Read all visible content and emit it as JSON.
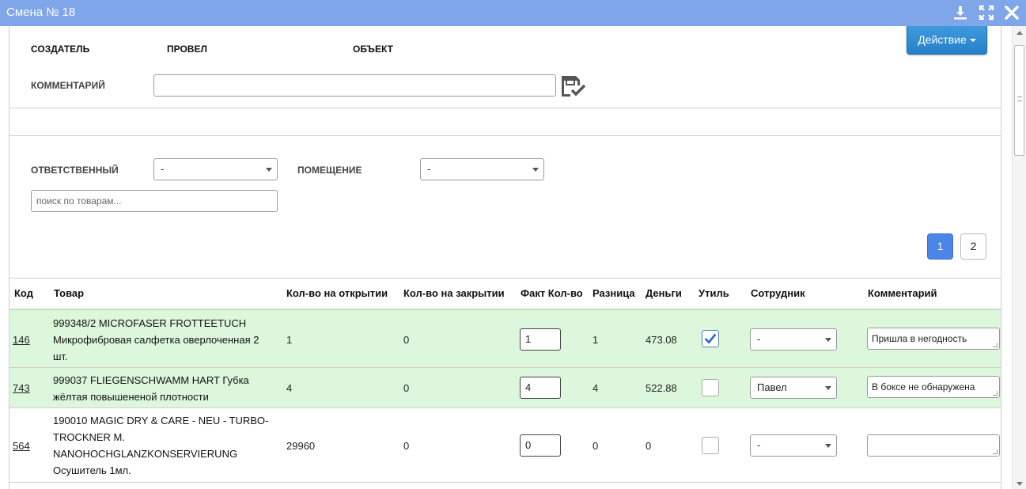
{
  "window": {
    "title": "Смена № 18"
  },
  "header": {
    "creator_label": "СОЗДАТЕЛЬ",
    "conducted_label": "ПРОВЕЛ",
    "object_label": "ОБЪЕКТ",
    "comment_label": "КОММЕНТАРИЙ",
    "comment_value": "",
    "action_label": "Действие"
  },
  "filters": {
    "responsible_label": "ОТВЕТСТВЕННЫЙ",
    "responsible_value": "-",
    "room_label": "ПОМЕЩЕНИЕ",
    "room_value": "-",
    "search_placeholder": "поиск по товарам..."
  },
  "pagination": {
    "pages": [
      "1",
      "2"
    ],
    "active": "1"
  },
  "table": {
    "columns": [
      "Код",
      "Товар",
      "Кол-во на открытии",
      "Кол-во на закрытии",
      "Факт Кол-во",
      "Разница",
      "Деньги",
      "Утиль",
      "Сотрудник",
      "Комментарий"
    ],
    "rows": [
      {
        "code": "146",
        "product_lines": [
          "999348/2 MICROFASER FROTTEETUCH",
          "Микрофибровая салфетка оверлоченная 2",
          "шт."
        ],
        "qty_open": "1",
        "qty_close": "0",
        "fact": "1",
        "diff": "1",
        "money": "473.08",
        "util": true,
        "employee": "-",
        "comment": "Пришла в негодность"
      },
      {
        "code": "743",
        "product_lines": [
          "999037 FLIEGENSCHWAMM HART Губка",
          "жёлтая повышененой плотности"
        ],
        "qty_open": "4",
        "qty_close": "0",
        "fact": "4",
        "diff": "4",
        "money": "522.88",
        "util": false,
        "employee": "Павел",
        "comment": "В боксе не обнаружена"
      },
      {
        "code": "564",
        "product_lines": [
          "190010 MAGIC DRY & CARE - NEU - TURBO-",
          "TROCKNER M.",
          "NANOHOCHGLANZKONSERVIERUNG",
          "Осушитель 1мл."
        ],
        "qty_open": "29960",
        "qty_close": "0",
        "fact": "0",
        "diff": "0",
        "money": "0",
        "util": false,
        "employee": "-",
        "comment": ""
      }
    ]
  },
  "colors": {
    "titlebar": "#7ea6e8",
    "action_button": "#2f8ad6",
    "row_highlight": "#dcf7dc",
    "page_active": "#4a86e8"
  },
  "icons": {
    "download": "download-icon",
    "maximize": "maximize-icon",
    "close": "close-icon",
    "save_comment": "save-check-icon"
  }
}
